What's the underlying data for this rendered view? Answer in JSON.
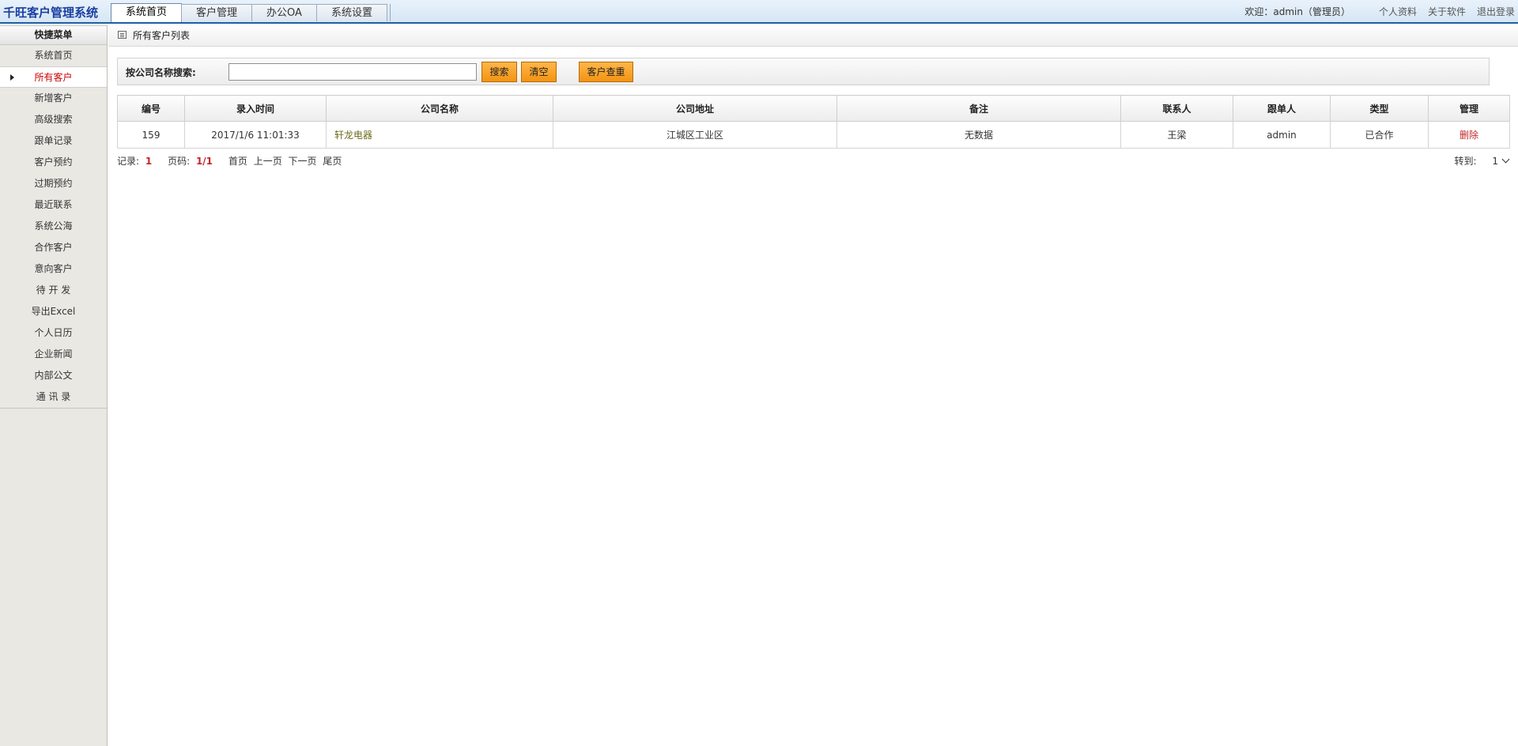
{
  "app": {
    "title": "千旺客户管理系统"
  },
  "tabs": [
    "系统首页",
    "客户管理",
    "办公OA",
    "系统设置"
  ],
  "header": {
    "welcome": "欢迎：admin（管理员）",
    "links": [
      "个人资料",
      "关于软件",
      "退出登录"
    ]
  },
  "sidebar": {
    "title": "快捷菜单",
    "items": [
      "系统首页",
      "所有客户",
      "新增客户",
      "高级搜索",
      "跟单记录",
      "客户预约",
      "过期预约",
      "最近联系",
      "系统公海",
      "合作客户",
      "意向客户",
      "待 开 发",
      "导出Excel",
      "个人日历",
      "企业新闻",
      "内部公文",
      "通 讯 录"
    ],
    "active_index": 1
  },
  "page": {
    "title": "所有客户列表"
  },
  "search": {
    "label": "按公司名称搜索:",
    "value": "",
    "search_button": "搜索",
    "clear_button": "清空",
    "dup_button": "客户查重"
  },
  "table": {
    "headers": [
      "编号",
      "录入时间",
      "公司名称",
      "公司地址",
      "备注",
      "联系人",
      "跟单人",
      "类型",
      "管理"
    ],
    "rows": [
      {
        "id": "159",
        "time": "2017/1/6 11:01:33",
        "company": "轩龙电器",
        "address": "江城区工业区",
        "note": "无数据",
        "contact": "王梁",
        "owner": "admin",
        "type": "已合作",
        "action": "删除"
      }
    ]
  },
  "pager": {
    "records_label": "记录:",
    "records": "1",
    "page_label": "页码:",
    "page": "1/1",
    "first": "首页",
    "prev": "上一页",
    "next": "下一页",
    "last": "尾页",
    "jump_label": "转到:",
    "jump_value": "1"
  },
  "colors": {
    "brand": "#1a3fa0",
    "active_menu": "#cc0000",
    "button": "#f29412"
  }
}
